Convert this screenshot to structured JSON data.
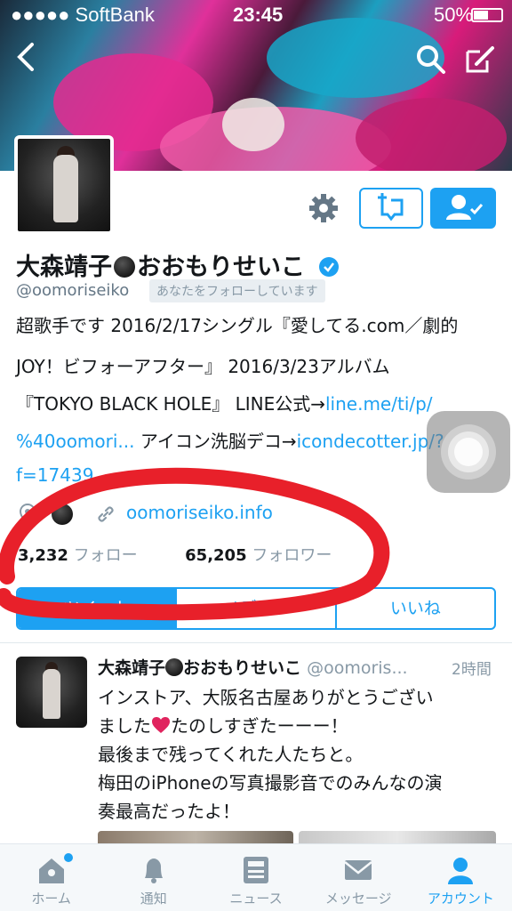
{
  "status_bar": {
    "carrier": "●●●●● SoftBank",
    "time": "23:45",
    "battery": "50%"
  },
  "profile": {
    "name_part1": "大森靖子",
    "name_part2": "おおもりせいこ",
    "handle": "@oomoriseiko",
    "follows_you": "あなたをフォローしています",
    "bio": {
      "line1": "超歌手です 2016/2/17シングル『愛してる.com／劇的",
      "line2": "JOY！ビフォーアフター』 2016/3/23アルバム",
      "line3_text": "『TOKYO BLACK HOLE』 LINE公式→",
      "line3_link": "line.me/ti/p/",
      "line4_link1": "%40oomori...",
      "line4_text": " アイコン洗脳デコ→",
      "line4_link2": "icondecotter.jp/?",
      "line5_link": "f=17439"
    },
    "website": "oomoriseiko.info",
    "following_count": "3,232",
    "following_label": "フォロー",
    "followers_count": "65,205",
    "followers_label": "フォロワー"
  },
  "tabs": [
    {
      "label": "ツイート",
      "active": true
    },
    {
      "label": "メディア",
      "active": false
    },
    {
      "label": "いいね",
      "active": false
    }
  ],
  "tweet": {
    "name_part1": "大森靖子",
    "name_part2": "おおもりせいこ",
    "handle": "@oomoris...",
    "time": "2時間",
    "line1": "インストア、大阪名古屋ありがとうござい",
    "line2_a": "ました",
    "line2_b": "たのしすぎたーーー！",
    "line3": "最後まで残ってくれた人たちと。",
    "line4": "梅田のiPhoneの写真撮影音でのみんなの演",
    "line5": "奏最高だったよ！"
  },
  "bottom_nav": [
    {
      "label": "ホーム",
      "icon": "home-icon"
    },
    {
      "label": "通知",
      "icon": "bell-icon"
    },
    {
      "label": "ニュース",
      "icon": "news-icon"
    },
    {
      "label": "メッセージ",
      "icon": "envelope-icon"
    },
    {
      "label": "アカウント",
      "icon": "person-icon",
      "active": true
    }
  ],
  "colors": {
    "accent": "#1da1f2",
    "scribble": "#e8202a"
  }
}
